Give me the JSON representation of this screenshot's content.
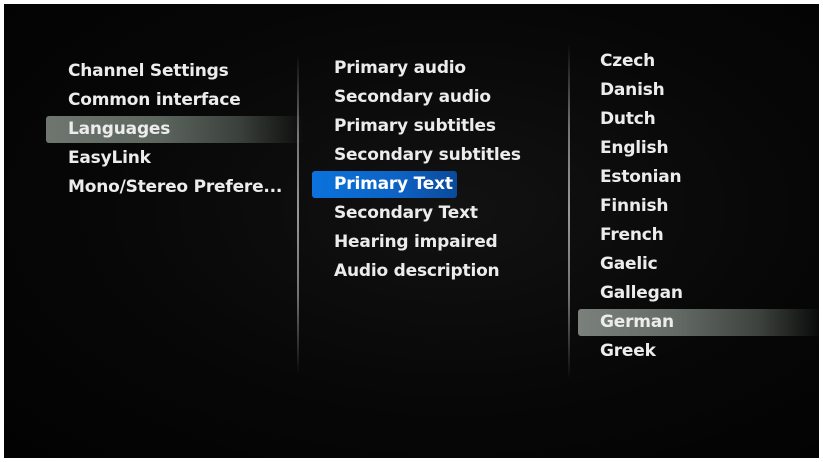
{
  "menu_level1": {
    "items": [
      {
        "label": "Channel Settings"
      },
      {
        "label": "Common interface"
      },
      {
        "label": "Languages"
      },
      {
        "label": "EasyLink"
      },
      {
        "label": "Mono/Stereo Prefere..."
      }
    ],
    "selected": "Languages"
  },
  "menu_level2": {
    "items": [
      {
        "label": "Primary audio"
      },
      {
        "label": "Secondary audio"
      },
      {
        "label": "Primary subtitles"
      },
      {
        "label": "Secondary subtitles"
      },
      {
        "label": "Primary Text"
      },
      {
        "label": "Secondary Text"
      },
      {
        "label": "Hearing impaired"
      },
      {
        "label": "Audio description"
      }
    ],
    "selected": "Primary Text"
  },
  "menu_level3": {
    "items": [
      {
        "label": "Czech"
      },
      {
        "label": "Danish"
      },
      {
        "label": "Dutch"
      },
      {
        "label": "English"
      },
      {
        "label": "Estonian"
      },
      {
        "label": "Finnish"
      },
      {
        "label": "French"
      },
      {
        "label": "Gaelic"
      },
      {
        "label": "Gallegan"
      },
      {
        "label": "German"
      },
      {
        "label": "Greek"
      }
    ],
    "selected": "German"
  },
  "colors": {
    "background": "#050505",
    "text": "#ececec",
    "focus_highlight": "#0a73dc",
    "path_highlight": "#6f7670"
  }
}
